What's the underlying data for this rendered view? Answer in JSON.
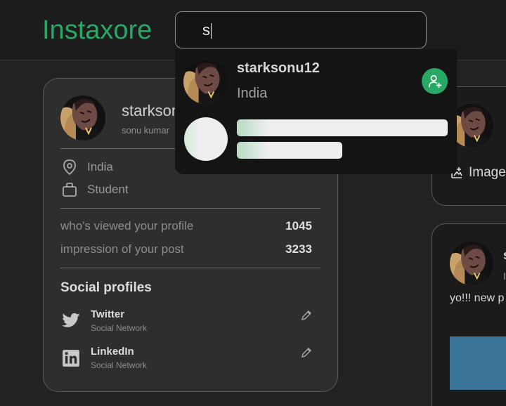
{
  "navbar": {
    "logo": "Instaxore",
    "search_value": "s"
  },
  "search_dropdown": {
    "result": {
      "username": "starksonu12",
      "country": "India",
      "follow_icon": "person-add-icon"
    },
    "loading_icon": "skeleton-placeholder"
  },
  "profile_card": {
    "name": "starksonu12",
    "full_name": "sonu kumar",
    "location": "India",
    "occupation": "Student",
    "stats": [
      {
        "label": "who's viewed your profile",
        "value": "1045"
      },
      {
        "label": "impression of your post",
        "value": "3233"
      }
    ],
    "social_title": "Social profiles",
    "socials": [
      {
        "name": "Twitter",
        "type": "Social Network",
        "icon": "twitter-icon"
      },
      {
        "name": "LinkedIn",
        "type": "Social Network",
        "icon": "linkedin-icon"
      }
    ]
  },
  "share_card": {
    "image_label": "Image"
  },
  "post_card": {
    "name": "s",
    "sub": "I",
    "text": "yo!!! new p"
  },
  "colors": {
    "brand": "#28a865",
    "background": "#222222",
    "card": "#2e2e2e",
    "media": "#3a7599"
  }
}
